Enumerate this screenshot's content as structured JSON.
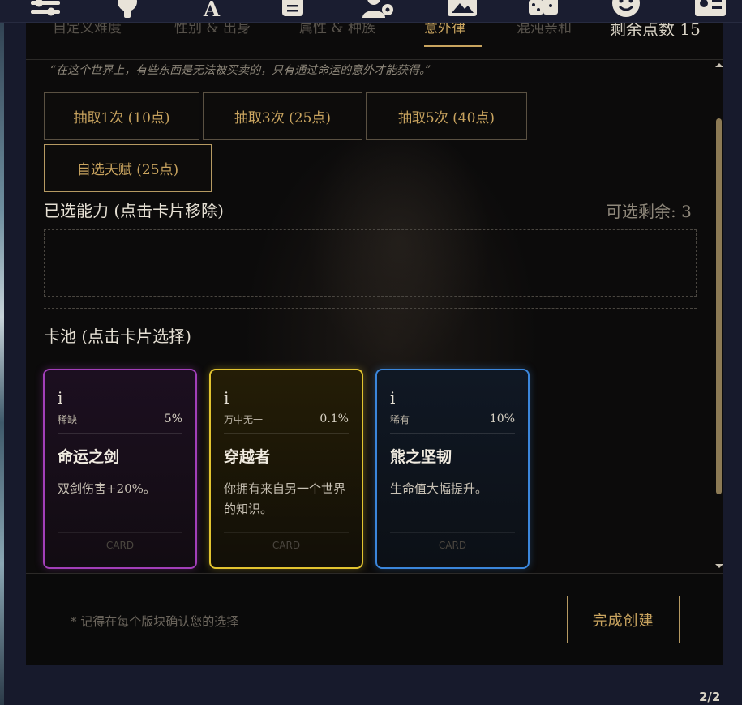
{
  "tabs": [
    {
      "label": "自定义难度"
    },
    {
      "label": "性别 & 出身"
    },
    {
      "label": "属性 & 种族"
    },
    {
      "label": "意外律",
      "active": true
    },
    {
      "label": "混沌亲和"
    }
  ],
  "points_label": "剩余点数 15",
  "quote": "“在这个世界上，有些东西是无法被买卖的，只有通过命运的意外才能获得。”",
  "draw_buttons": [
    {
      "label": "抽取1次 (10点)"
    },
    {
      "label": "抽取3次 (25点)"
    },
    {
      "label": "抽取5次 (40点)"
    }
  ],
  "choose_button": "自选天赋 (25点)",
  "selected_section": {
    "title": "已选能力 (点击卡片移除)",
    "remaining": "可选剩余: 3"
  },
  "pool_section": {
    "title": "卡池 (点击卡片选择)"
  },
  "cards": [
    {
      "info": "i",
      "rarity": "稀缺",
      "percent": "5%",
      "name": "命运之剑",
      "desc": "双剑伤害+20%。",
      "tag": "CARD",
      "color": "#a23fb9"
    },
    {
      "info": "i",
      "rarity": "万中无一",
      "percent": "0.1%",
      "name": "穿越者",
      "desc": "你拥有来自另一个世界的知识。",
      "tag": "CARD",
      "color": "#e2c430"
    },
    {
      "info": "i",
      "rarity": "稀有",
      "percent": "10%",
      "name": "熊之坚韧",
      "desc": "生命值大幅提升。",
      "tag": "CARD",
      "color": "#3b86db"
    }
  ],
  "footer": {
    "note": "* 记得在每个版块确认您的选择",
    "finish_label": "完成创建"
  },
  "pager": "2/2",
  "icons": [
    "sliders-icon",
    "bulb-icon",
    "font-icon",
    "scroll-icon",
    "user-gear-icon",
    "mountain-icon",
    "dice-icon",
    "smile-icon",
    "id-card-icon"
  ]
}
